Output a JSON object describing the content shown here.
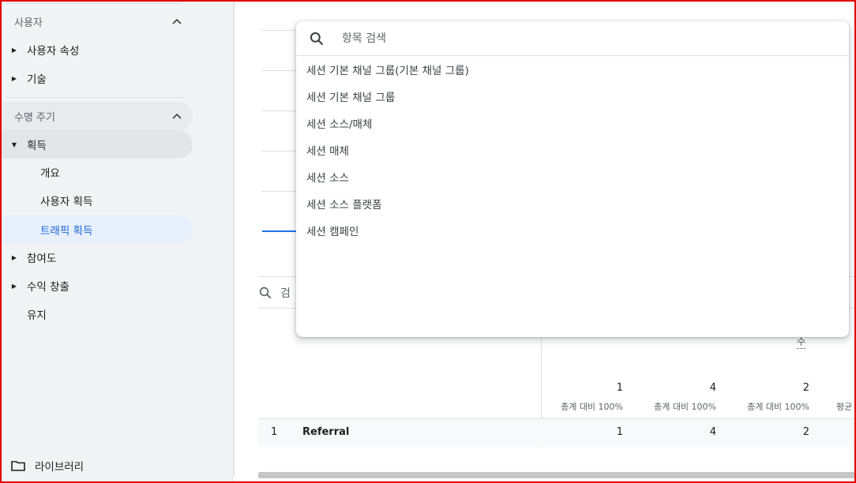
{
  "sidebar": {
    "users_section": "사용자",
    "user_attributes": "사용자 속성",
    "tech": "기술",
    "lifecycle_section": "수명 주기",
    "acquisition": "획득",
    "overview": "개요",
    "user_acquisition": "사용자 획득",
    "traffic_acquisition": "트래픽 획득",
    "engagement": "참여도",
    "monetization": "수익 창출",
    "retention": "유지",
    "library": "라이브러리"
  },
  "dropdown": {
    "search_placeholder": "항목 검색",
    "items": [
      "세션 기본 채널 그룹(기본 채널 그룹)",
      "세션 기본 채널 그룹",
      "세션 소스/매체",
      "세션 매체",
      "세션 소스",
      "세션 소스 플랫폼",
      "세션 캠페인"
    ]
  },
  "table": {
    "search_partial": "검",
    "header_partial": "수",
    "totals": [
      "1",
      "4",
      "2"
    ],
    "totals_sub": [
      "총계 대비 100%",
      "총계 대비 100%",
      "총계 대비 100%"
    ],
    "partial_sub": "평균",
    "row": {
      "index": "1",
      "channel": "Referral",
      "values": [
        "1",
        "4",
        "2"
      ]
    }
  }
}
